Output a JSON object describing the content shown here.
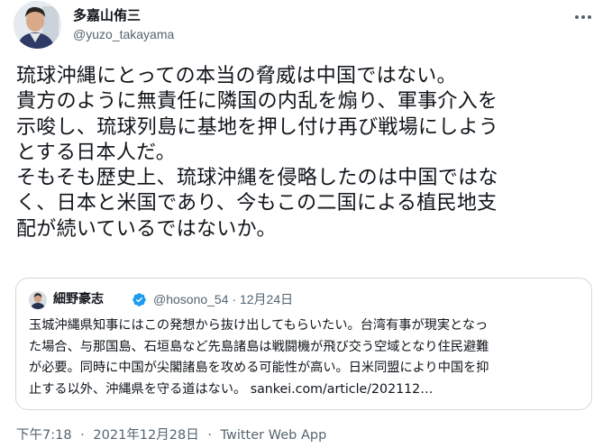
{
  "author": {
    "display_name": "多嘉山侑三",
    "handle": "@yuzo_takayama"
  },
  "tweet": {
    "lines": [
      "琉球沖縄にとっての本当の脅威は中国ではない。",
      "貴方のように無責任に隣国の内乱を煽り、軍事介入を",
      "示唆し、琉球列島に基地を押し付け再び戦場にしよう",
      "とする日本人だ。",
      "そもそも歴史上、琉球沖縄を侵略したのは中国ではな",
      "く、日本と米国であり、今もこの二国による植民地支",
      "配が続いているではないか。"
    ]
  },
  "quoted": {
    "display_name": "細野豪志",
    "handle": "@hosono_54",
    "separator": "·",
    "date": "12月24日",
    "lines": [
      "玉城沖縄県知事にはこの発想から抜け出してもらいたい。台湾有事が現実となっ",
      "た場合、与那国島、石垣島など先島諸島は戦闘機が飛び交う空域となり住民避難",
      "が必要。同時に中国が尖閣諸島を攻める可能性が高い。日米同盟により中国を抑",
      "止する以外、沖縄県を守る道はない。 sankei.com/article/202112…"
    ]
  },
  "footer": {
    "time": "下午7:18",
    "date": "2021年12月28日",
    "source": "Twitter Web App",
    "separator": "·"
  },
  "colors": {
    "text": "#0f1419",
    "secondary": "#536471",
    "border": "#cfd9de",
    "verified": "#1d9bf0"
  },
  "icons": {
    "more": "more-horizontal-icon",
    "verified": "verified-badge-icon"
  }
}
